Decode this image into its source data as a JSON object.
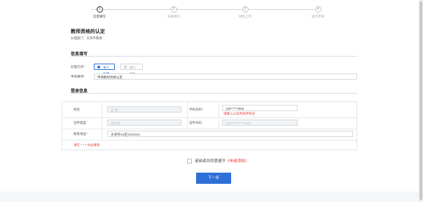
{
  "steps": [
    {
      "num": "1",
      "label": "信息填写",
      "active": true
    },
    {
      "num": "2",
      "label": "资格填写",
      "active": false
    },
    {
      "num": "3",
      "label": "材料上传",
      "active": false
    },
    {
      "num": "4",
      "label": "提交申请",
      "active": false
    }
  ],
  "page": {
    "title": "教师资格的认定",
    "subtitle": "办理部门：天津市教委"
  },
  "info_section": {
    "title": "信息填写",
    "method_label": "办理方式*",
    "method_options": [
      "本人办理",
      "他人代办"
    ],
    "selected_method": "本人办理",
    "matter_label": "申请事项*",
    "matter_value": "申请教师资格认定"
  },
  "login_section": {
    "title": "登录信息",
    "name_label": "姓名",
    "name_placeholder": "王*某",
    "phone_label": "手机号码*",
    "phone_value": "138*****7865",
    "phone_error": "请输入11位有效手机号",
    "idtype_label": "证件类型",
    "idtype_placeholder": "身份证",
    "idnum_label": "证件号码",
    "idnum_placeholder": "320***********8123",
    "address_label": "联系地址*",
    "address_value": "天津市XX区XXXXXX",
    "form_error": "请在 * * * 为必填项"
  },
  "agreement": {
    "text": "请阅读并同意遵守",
    "link": "《申请须知》"
  },
  "next_button": "下一步"
}
